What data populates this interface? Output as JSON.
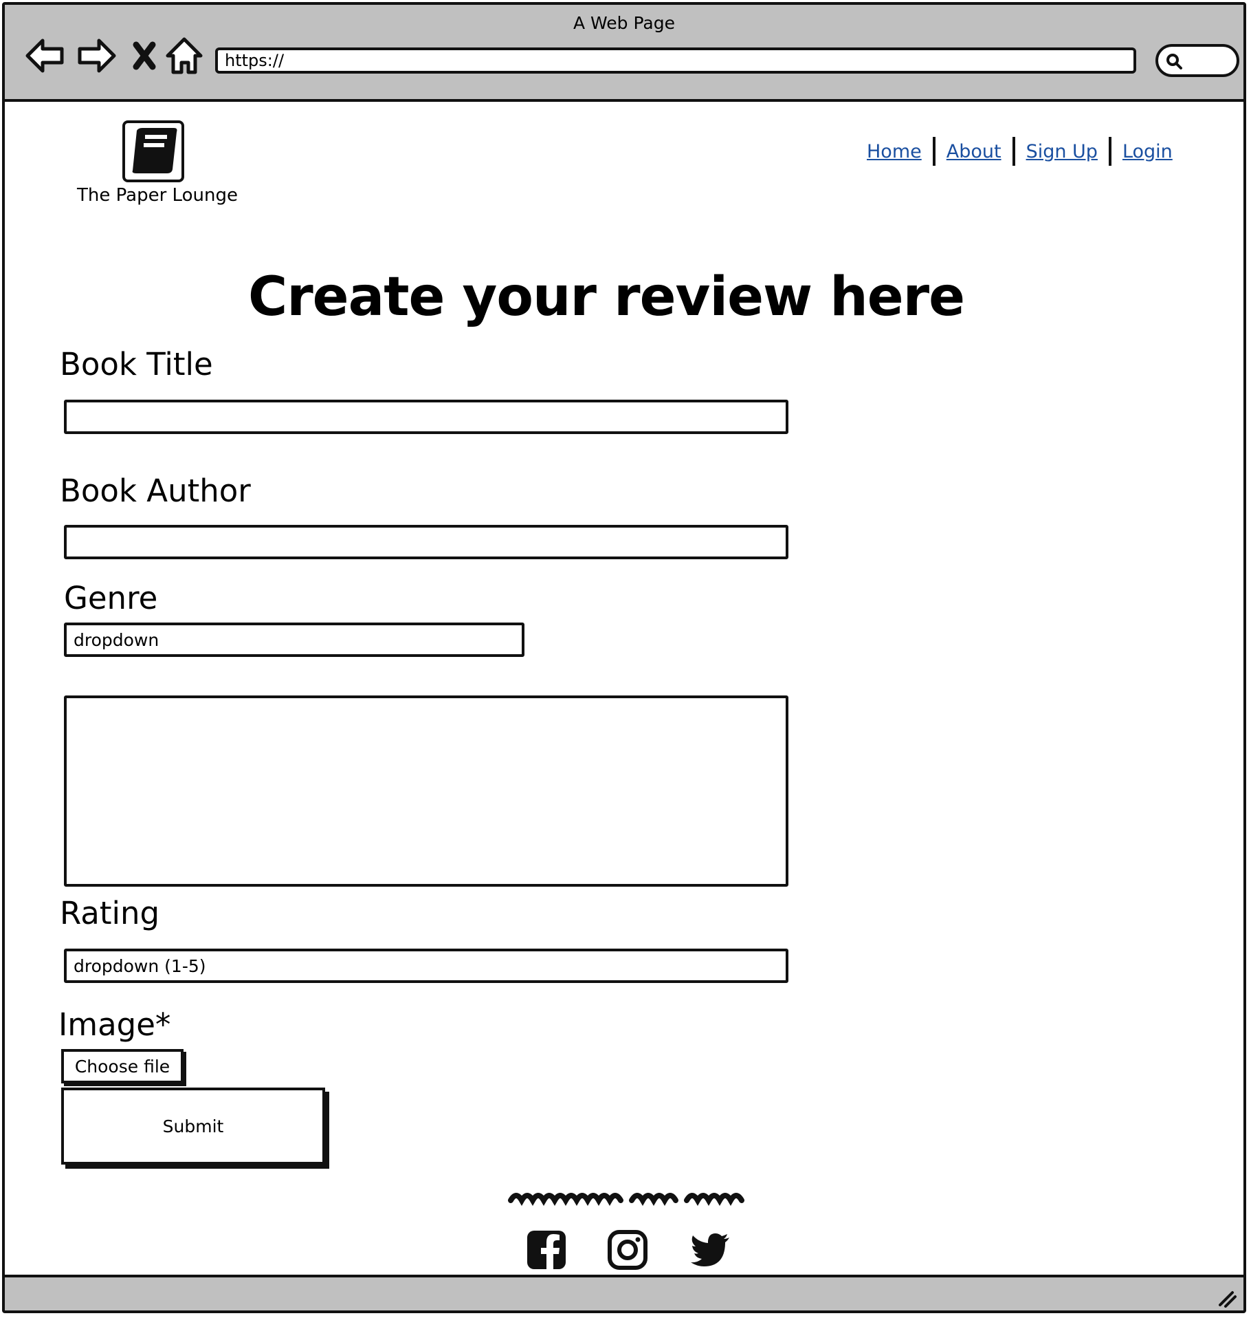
{
  "window": {
    "title": "A Web Page",
    "url": "https://"
  },
  "browser_controls": {
    "back_icon": "back-arrow-icon",
    "forward_icon": "forward-arrow-icon",
    "stop_icon": "close-icon",
    "home_icon": "home-icon",
    "search_icon": "search-icon"
  },
  "header": {
    "logo_icon": "book-icon",
    "brand_name": "The Paper Lounge",
    "nav": [
      "Home",
      "About",
      "Sign Up",
      "Login"
    ]
  },
  "main": {
    "title": "Create your review here",
    "fields": {
      "book_title_label": "Book Title",
      "book_author_label": "Book Author",
      "genre_label": "Genre",
      "genre_value": "dropdown",
      "rating_label": "Rating",
      "rating_value": "dropdown (1-5)",
      "image_label": "Image*",
      "choose_file": "Choose file",
      "submit": "Submit"
    }
  },
  "footer": {
    "social_icons": [
      "facebook-icon",
      "instagram-icon",
      "twitter-icon"
    ]
  },
  "colors": {
    "chrome": "#c0c0c0",
    "link": "#1a4fa0",
    "stroke": "#111111"
  }
}
